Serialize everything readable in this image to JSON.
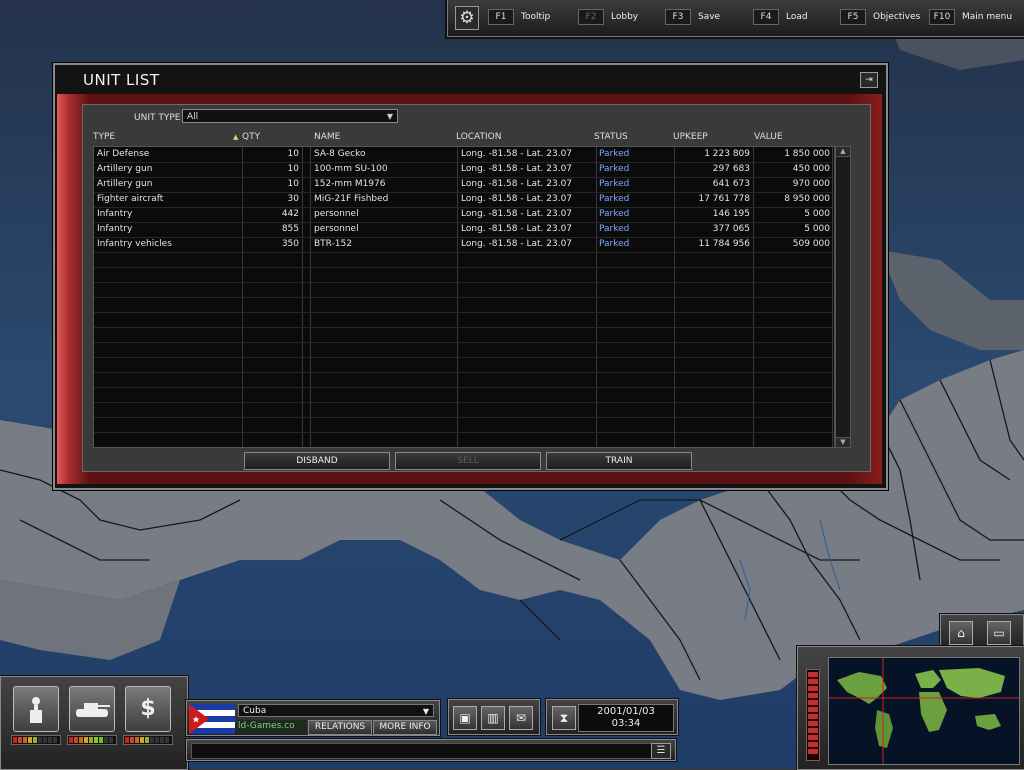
{
  "hotkeys": {
    "settings_icon": "gear-icon",
    "items": [
      {
        "key": "F1",
        "label": "Tooltip",
        "enabled": true
      },
      {
        "key": "F2",
        "label": "Lobby",
        "enabled": false
      },
      {
        "key": "F3",
        "label": "Save",
        "enabled": true
      },
      {
        "key": "F4",
        "label": "Load",
        "enabled": true
      },
      {
        "key": "F5",
        "label": "Objectives",
        "enabled": true
      },
      {
        "key": "F10",
        "label": "Main menu",
        "enabled": true
      }
    ]
  },
  "unit_list": {
    "title": "UNIT LIST",
    "close_icon": "exit-icon",
    "filter": {
      "label": "UNIT TYPE",
      "value": "All"
    },
    "columns": [
      "TYPE",
      "QTY",
      "NAME",
      "LOCATION",
      "STATUS",
      "UPKEEP",
      "VALUE"
    ],
    "sort_indicator": "▲",
    "rows": [
      {
        "type": "Air Defense",
        "qty": "10",
        "name": "SA-8 Gecko",
        "location": "Long. -81.58 - Lat. 23.07",
        "status": "Parked",
        "upkeep": "1 223 809",
        "value": "1 850 000"
      },
      {
        "type": "Artillery gun",
        "qty": "10",
        "name": "100-mm SU-100",
        "location": "Long. -81.58 - Lat. 23.07",
        "status": "Parked",
        "upkeep": "297 683",
        "value": "450 000"
      },
      {
        "type": "Artillery gun",
        "qty": "10",
        "name": "152-mm M1976",
        "location": "Long. -81.58 - Lat. 23.07",
        "status": "Parked",
        "upkeep": "641 673",
        "value": "970 000"
      },
      {
        "type": "Fighter aircraft",
        "qty": "30",
        "name": "MiG-21F Fishbed",
        "location": "Long. -81.58 - Lat. 23.07",
        "status": "Parked",
        "upkeep": "17 761 778",
        "value": "8 950 000"
      },
      {
        "type": "Infantry",
        "qty": "442",
        "name": "personnel",
        "location": "Long. -81.58 - Lat. 23.07",
        "status": "Parked",
        "upkeep": "146 195",
        "value": "5 000"
      },
      {
        "type": "Infantry",
        "qty": "855",
        "name": "personnel",
        "location": "Long. -81.58 - Lat. 23.07",
        "status": "Parked",
        "upkeep": "377 065",
        "value": "5 000"
      },
      {
        "type": "Infantry vehicles",
        "qty": "350",
        "name": "BTR-152",
        "location": "Long. -81.58 - Lat. 23.07",
        "status": "Parked",
        "upkeep": "11 784 956",
        "value": "509 000"
      }
    ],
    "buttons": {
      "disband": "DISBAND",
      "sell": "SELL",
      "train": "TRAIN"
    }
  },
  "hud": {
    "left_buttons": [
      "politics-icon",
      "tank-icon",
      "dollar-icon"
    ],
    "country": "Cuba",
    "site_text": "ld-Games.co",
    "relations_label": "RELATIONS",
    "more_info_label": "MORE INFO",
    "tools": [
      "computer-icon",
      "chart-icon",
      "mail-icon"
    ],
    "date": "2001/01/03",
    "time": "03:34"
  }
}
